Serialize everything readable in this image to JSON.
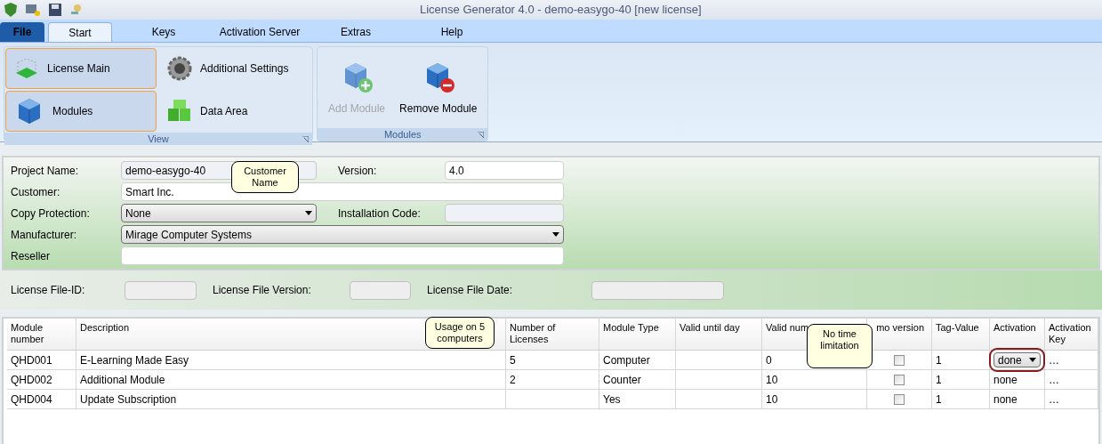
{
  "window": {
    "title": "License Generator 4.0  - demo-easygo-40 [new license]"
  },
  "file_menu": {
    "label": "File"
  },
  "menu_tabs": [
    {
      "label": "Start",
      "selected": true
    },
    {
      "label": "Keys",
      "selected": false
    },
    {
      "label": "Activation Server",
      "selected": false
    },
    {
      "label": "Extras",
      "selected": false
    },
    {
      "label": "Help",
      "selected": false
    }
  ],
  "ribbon": {
    "groups": [
      {
        "label": "View",
        "kind": "view",
        "items": [
          {
            "label": "License Main",
            "selected": true
          },
          {
            "label": "Additional Settings",
            "selected": false
          },
          {
            "label": "Modules",
            "selected": true
          },
          {
            "label": "Data Area",
            "selected": false
          }
        ]
      },
      {
        "label": "Modules",
        "kind": "modules",
        "items": [
          {
            "label": "Add Module",
            "disabled": true
          },
          {
            "label": "Remove Module",
            "disabled": false
          }
        ]
      }
    ]
  },
  "project": {
    "fields": [
      {
        "label": "Project Name:",
        "value": "demo-easygo-40",
        "kind": "readonly"
      },
      {
        "label": "Version:",
        "value": "4.0",
        "kind": "text"
      },
      {
        "label": "Customer:",
        "value": "Smart Inc.",
        "kind": "text"
      },
      {
        "label": "Copy Protection:",
        "value": "None",
        "kind": "select"
      },
      {
        "label": "Installation Code:",
        "kind": "readonly"
      },
      {
        "label": "Manufacturer:",
        "value": "Mirage Computer Systems",
        "kind": "select"
      },
      {
        "label": "Reseller",
        "kind": "text"
      }
    ]
  },
  "license_file": [
    {
      "label": "License File-ID:"
    },
    {
      "label": "License File Version:"
    },
    {
      "label": "License File Date:"
    }
  ],
  "table": {
    "columns": [
      "Module number",
      "Description",
      "Number of Licenses",
      "Module Type",
      "Valid until day",
      "Valid num",
      "mo version",
      "Tag-Value",
      "Activation",
      "Activation Key"
    ],
    "rows": [
      {
        "module_number": "QHD001",
        "description": "E-Learning Made Easy",
        "licenses": "5",
        "module_type": "Computer",
        "valid_num": "0",
        "demo_checked": false,
        "tag_value": "1",
        "activation": {
          "value": "done",
          "kind": "dropdown"
        },
        "activation_key": "…"
      },
      {
        "module_number": "QHD002",
        "description": "Additional Module",
        "licenses": "2",
        "module_type": "Counter",
        "valid_num": "10",
        "demo_checked": false,
        "tag_value": "1",
        "activation": {
          "value": "none",
          "kind": "text"
        },
        "activation_key": "…"
      },
      {
        "module_number": "QHD004",
        "description": "Update Subscription",
        "module_type": "Yes",
        "valid_num": "10",
        "demo_checked": false,
        "tag_value": "1",
        "activation": {
          "value": "none",
          "kind": "text"
        },
        "activation_key": "…"
      }
    ]
  },
  "callouts": [
    {
      "text": "Customer Name"
    },
    {
      "text": "Usage on 5 computers"
    },
    {
      "text": "No time limitation"
    }
  ]
}
